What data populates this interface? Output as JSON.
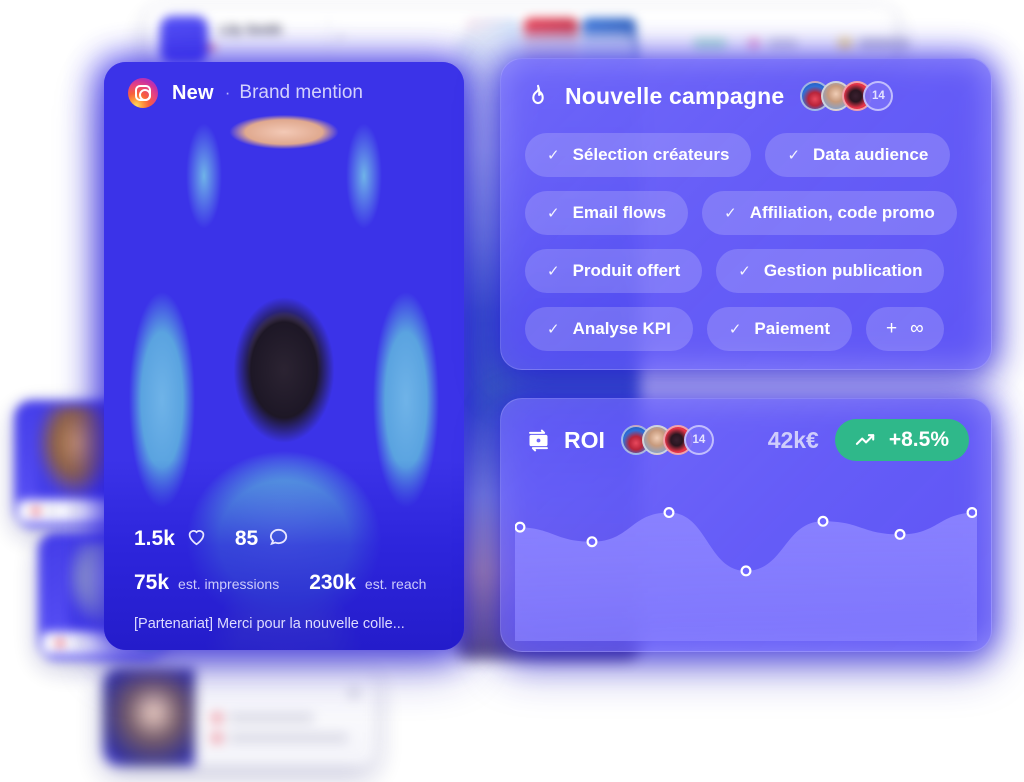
{
  "post": {
    "platform_icon": "instagram-icon",
    "status_label": "New",
    "separator": "·",
    "type_label": "Brand mention",
    "likes": "1.5k",
    "heart_icon": "heart-icon",
    "comments": "85",
    "comment_icon": "comment-icon",
    "impressions_value": "75k",
    "impressions_label": "est. impressions",
    "reach_value": "230k",
    "reach_label": "est. reach",
    "caption": "[Partenariat] Merci pour la nouvelle colle..."
  },
  "campaign": {
    "icon": "flame-icon",
    "title": "Nouvelle campagne",
    "avatar_count": "14",
    "check_icon": "check-icon",
    "chips": [
      [
        {
          "label": "Sélection créateurs",
          "checked": true
        },
        {
          "label": "Data audience",
          "checked": true
        }
      ],
      [
        {
          "label": "Email flows",
          "checked": true
        },
        {
          "label": "Affiliation, code promo",
          "checked": true
        }
      ],
      [
        {
          "label": "Produit offert",
          "checked": true
        },
        {
          "label": "Gestion publication",
          "checked": true
        }
      ],
      [
        {
          "label": "Analyse KPI",
          "checked": true
        },
        {
          "label": "Paiement",
          "checked": true
        }
      ]
    ],
    "add_chip": {
      "plus": "+",
      "infinity": "∞"
    }
  },
  "roi": {
    "icon": "money-exchange-icon",
    "title": "ROI",
    "avatar_count": "14",
    "value": "42k€",
    "trend_icon": "trending-up-icon",
    "trend_label": "+8.5%"
  },
  "chart_data": {
    "type": "area",
    "title": "ROI",
    "x": [
      0,
      1,
      2,
      3,
      4,
      5,
      6
    ],
    "values": [
      78,
      68,
      88,
      48,
      82,
      73,
      88
    ],
    "ylim": [
      0,
      100
    ],
    "grid": false,
    "legend": null,
    "xlabel": "",
    "ylabel": "",
    "point_marker": "open-circle"
  },
  "background": {
    "top_panel_name": "Lily Smith",
    "colors": {
      "accent": "#3b33e8",
      "card": "#6f66ff",
      "success": "#2fb88a",
      "text": "#ffffff",
      "muted": "#cdcbfb"
    }
  }
}
